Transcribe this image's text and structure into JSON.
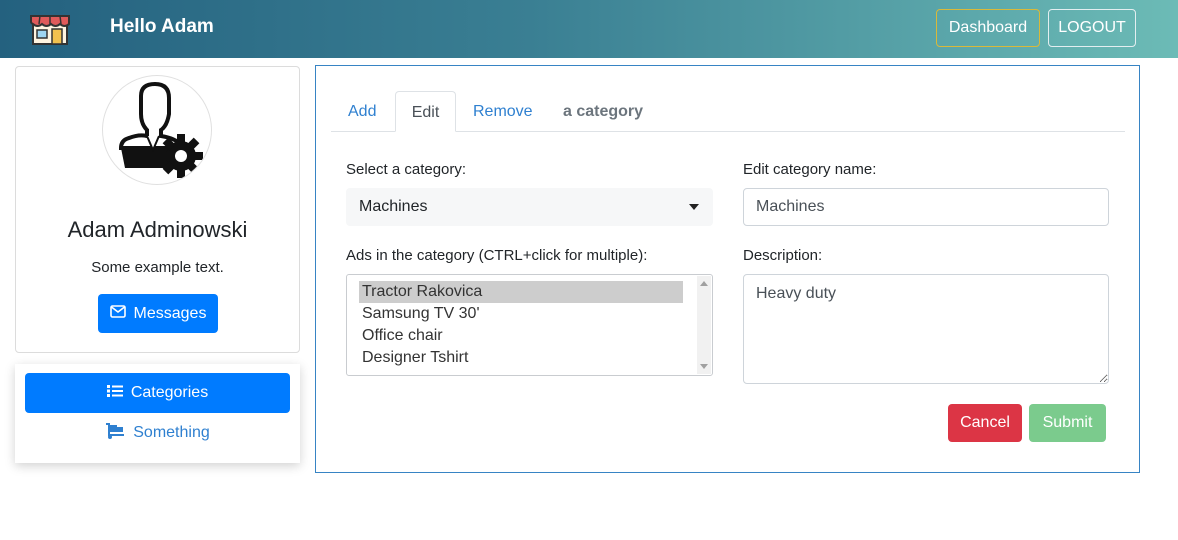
{
  "header": {
    "greeting": "Hello Adam",
    "logo_icon": "shop-icon",
    "dashboard_label": "Dashboard",
    "logout_label": "LOGOUT"
  },
  "profile": {
    "avatar_icon": "admin-user-gear-icon",
    "name": "Adam Adminowski",
    "text": "Some example text.",
    "messages_label": "Messages",
    "messages_icon": "envelope-icon"
  },
  "sidemenu": {
    "items": [
      {
        "label": "Categories",
        "icon": "list-icon",
        "active": true
      },
      {
        "label": "Something",
        "icon": "dolly-icon",
        "active": false
      }
    ]
  },
  "tabs": [
    {
      "label": "Add",
      "active": false
    },
    {
      "label": "Edit",
      "active": true
    },
    {
      "label": "Remove",
      "active": false
    }
  ],
  "tabs_suffix": "a category",
  "form": {
    "select_label": "Select a category:",
    "selected_category": "Machines",
    "ads_label": "Ads in the category (CTRL+click for multiple):",
    "ads": [
      {
        "label": "Tractor Rakovica",
        "selected": true
      },
      {
        "label": "Samsung TV 30'",
        "selected": false
      },
      {
        "label": "Office chair",
        "selected": false
      },
      {
        "label": "Designer Tshirt",
        "selected": false
      }
    ],
    "edit_name_label": "Edit category name:",
    "edit_name_value": "Machines",
    "description_label": "Description:",
    "description_value": "Heavy duty",
    "cancel_label": "Cancel",
    "submit_label": "Submit"
  },
  "colors": {
    "primary": "#007bff",
    "danger": "#dc3545",
    "success_disabled": "#7bcb8d",
    "header_start": "#24617f",
    "header_end": "#6cbbb6"
  }
}
